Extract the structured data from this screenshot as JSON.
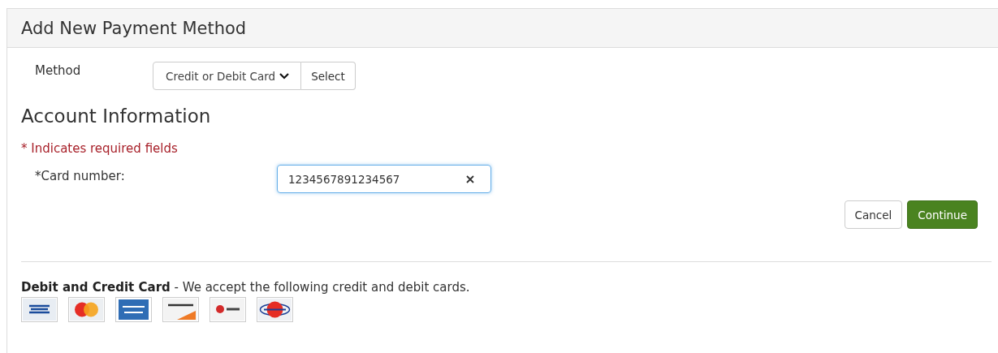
{
  "panel": {
    "title": "Add New Payment Method"
  },
  "method": {
    "label": "Method",
    "value": "Credit or Debit Card",
    "button": "Select"
  },
  "section": {
    "title": "Account Information",
    "required_note": "* Indicates required fields"
  },
  "card_number": {
    "label": "*Card number:",
    "value": "1234567891234567",
    "focused": true
  },
  "buttons": [
    {
      "label": "Cancel",
      "kind": "default"
    },
    {
      "label": "Continue",
      "kind": "primary"
    }
  ],
  "accepted": {
    "title": "Debit and Credit Card",
    "text": " - We accept the following credit and debit cards.",
    "cards": [
      {
        "kind": "visa"
      },
      {
        "kind": "circles"
      },
      {
        "kind": "amex"
      },
      {
        "kind": "discover"
      },
      {
        "kind": "bc"
      },
      {
        "kind": "dina"
      }
    ]
  }
}
